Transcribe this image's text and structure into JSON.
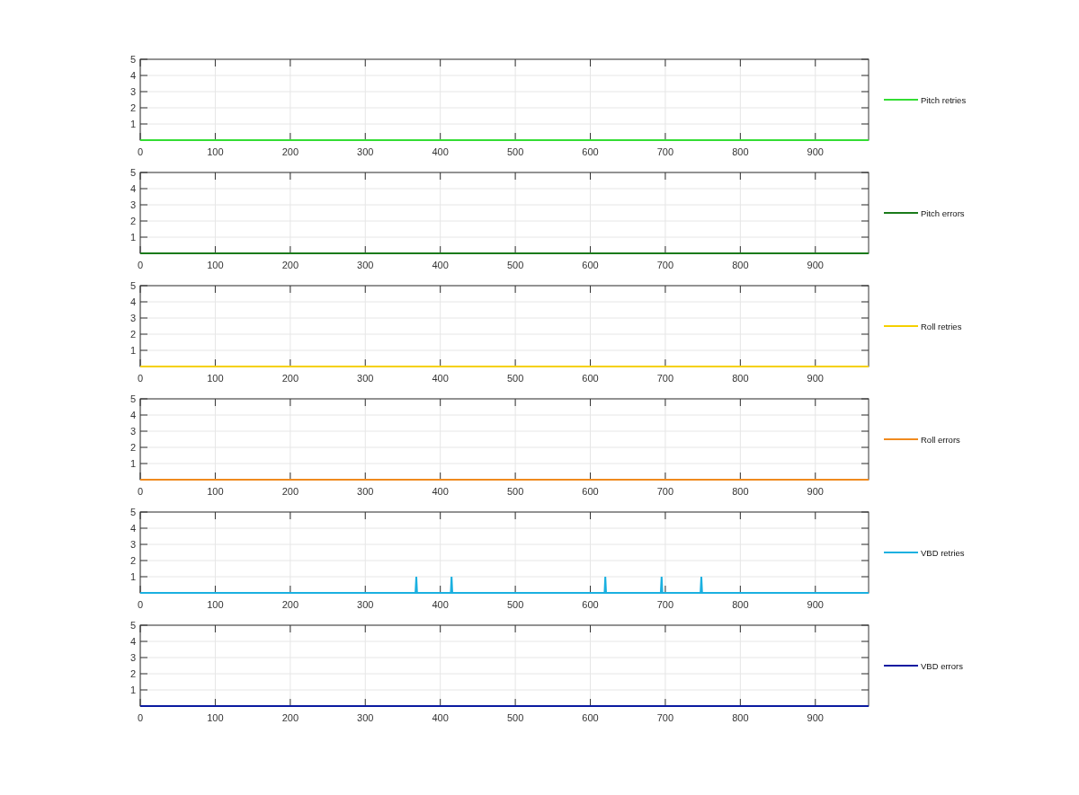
{
  "charts": [
    {
      "chart_data": {
        "type": "line",
        "grid": true,
        "xlim": [
          0,
          971
        ],
        "ylim": [
          0,
          5
        ],
        "xticks": [
          0,
          100,
          200,
          300,
          400,
          500,
          600,
          700,
          800,
          900
        ],
        "yticks": [
          1,
          2,
          3,
          4,
          5
        ],
        "x": [
          0,
          971
        ],
        "series": [
          {
            "name": "Pitch retries",
            "color": "#33dd33",
            "values": [
              0,
              0
            ]
          }
        ]
      }
    },
    {
      "chart_data": {
        "type": "line",
        "grid": true,
        "xlim": [
          0,
          971
        ],
        "ylim": [
          0,
          5
        ],
        "xticks": [
          0,
          100,
          200,
          300,
          400,
          500,
          600,
          700,
          800,
          900
        ],
        "yticks": [
          1,
          2,
          3,
          4,
          5
        ],
        "x": [
          0,
          971
        ],
        "series": [
          {
            "name": "Pitch errors",
            "color": "#1a7a1a",
            "values": [
              0,
              0
            ]
          }
        ]
      }
    },
    {
      "chart_data": {
        "type": "line",
        "grid": true,
        "xlim": [
          0,
          971
        ],
        "ylim": [
          0,
          5
        ],
        "xticks": [
          0,
          100,
          200,
          300,
          400,
          500,
          600,
          700,
          800,
          900
        ],
        "yticks": [
          1,
          2,
          3,
          4,
          5
        ],
        "x": [
          0,
          971
        ],
        "series": [
          {
            "name": "Roll retries",
            "color": "#f5d000",
            "values": [
              0,
              0
            ]
          }
        ]
      }
    },
    {
      "chart_data": {
        "type": "line",
        "grid": true,
        "xlim": [
          0,
          971
        ],
        "ylim": [
          0,
          5
        ],
        "xticks": [
          0,
          100,
          200,
          300,
          400,
          500,
          600,
          700,
          800,
          900
        ],
        "yticks": [
          1,
          2,
          3,
          4,
          5
        ],
        "x": [
          0,
          971
        ],
        "series": [
          {
            "name": "Roll errors",
            "color": "#f08a1e",
            "values": [
              0,
              0
            ]
          }
        ]
      }
    },
    {
      "chart_data": {
        "type": "line",
        "grid": true,
        "xlim": [
          0,
          971
        ],
        "ylim": [
          0,
          5
        ],
        "xticks": [
          0,
          100,
          200,
          300,
          400,
          500,
          600,
          700,
          800,
          900
        ],
        "yticks": [
          1,
          2,
          3,
          4,
          5
        ],
        "x": [
          0,
          367,
          368,
          369,
          414,
          415,
          416,
          619,
          620,
          621,
          694,
          695,
          696,
          747,
          748,
          749,
          971
        ],
        "series": [
          {
            "name": "VBD retries",
            "color": "#1ab0e0",
            "values": [
              0,
              0,
              1,
              0,
              0,
              1,
              0,
              0,
              1,
              0,
              0,
              1,
              0,
              0,
              1,
              0,
              0
            ]
          }
        ]
      }
    },
    {
      "chart_data": {
        "type": "line",
        "grid": true,
        "xlim": [
          0,
          971
        ],
        "ylim": [
          0,
          5
        ],
        "xticks": [
          0,
          100,
          200,
          300,
          400,
          500,
          600,
          700,
          800,
          900
        ],
        "yticks": [
          1,
          2,
          3,
          4,
          5
        ],
        "x": [
          0,
          971
        ],
        "series": [
          {
            "name": "VBD errors",
            "color": "#0a1aa0",
            "values": [
              0,
              0
            ]
          }
        ]
      }
    }
  ]
}
